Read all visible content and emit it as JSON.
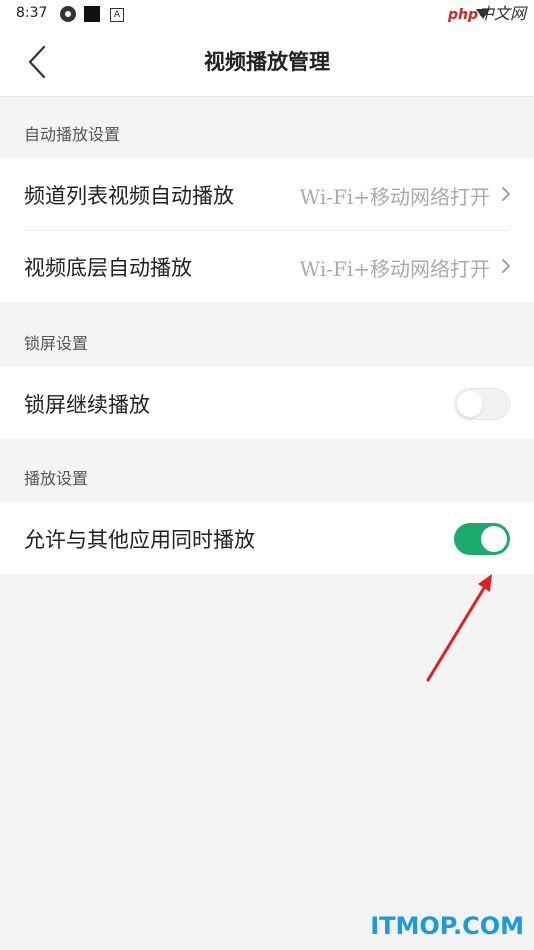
{
  "status_bar": {
    "time": "8:37",
    "watermark_php": "php",
    "watermark_cn": "中文网"
  },
  "header": {
    "title": "视频播放管理",
    "back_icon": "chevron-left-icon"
  },
  "sections": [
    {
      "title": "自动播放设置",
      "items": [
        {
          "label": "频道列表视频自动播放",
          "value": "Wi-Fi+移动网络打开"
        },
        {
          "label": "视频底层自动播放",
          "value": "Wi-Fi+移动网络打开"
        }
      ]
    },
    {
      "title": "锁屏设置",
      "items": [
        {
          "label": "锁屏继续播放",
          "toggle": false
        }
      ]
    },
    {
      "title": "播放设置",
      "items": [
        {
          "label": "允许与其他应用同时播放",
          "toggle": true
        }
      ]
    }
  ],
  "colors": {
    "toggle_on": "#1aaa6a",
    "annotation_arrow": "#e02020"
  },
  "footer_watermark": "ITMOP.COM"
}
